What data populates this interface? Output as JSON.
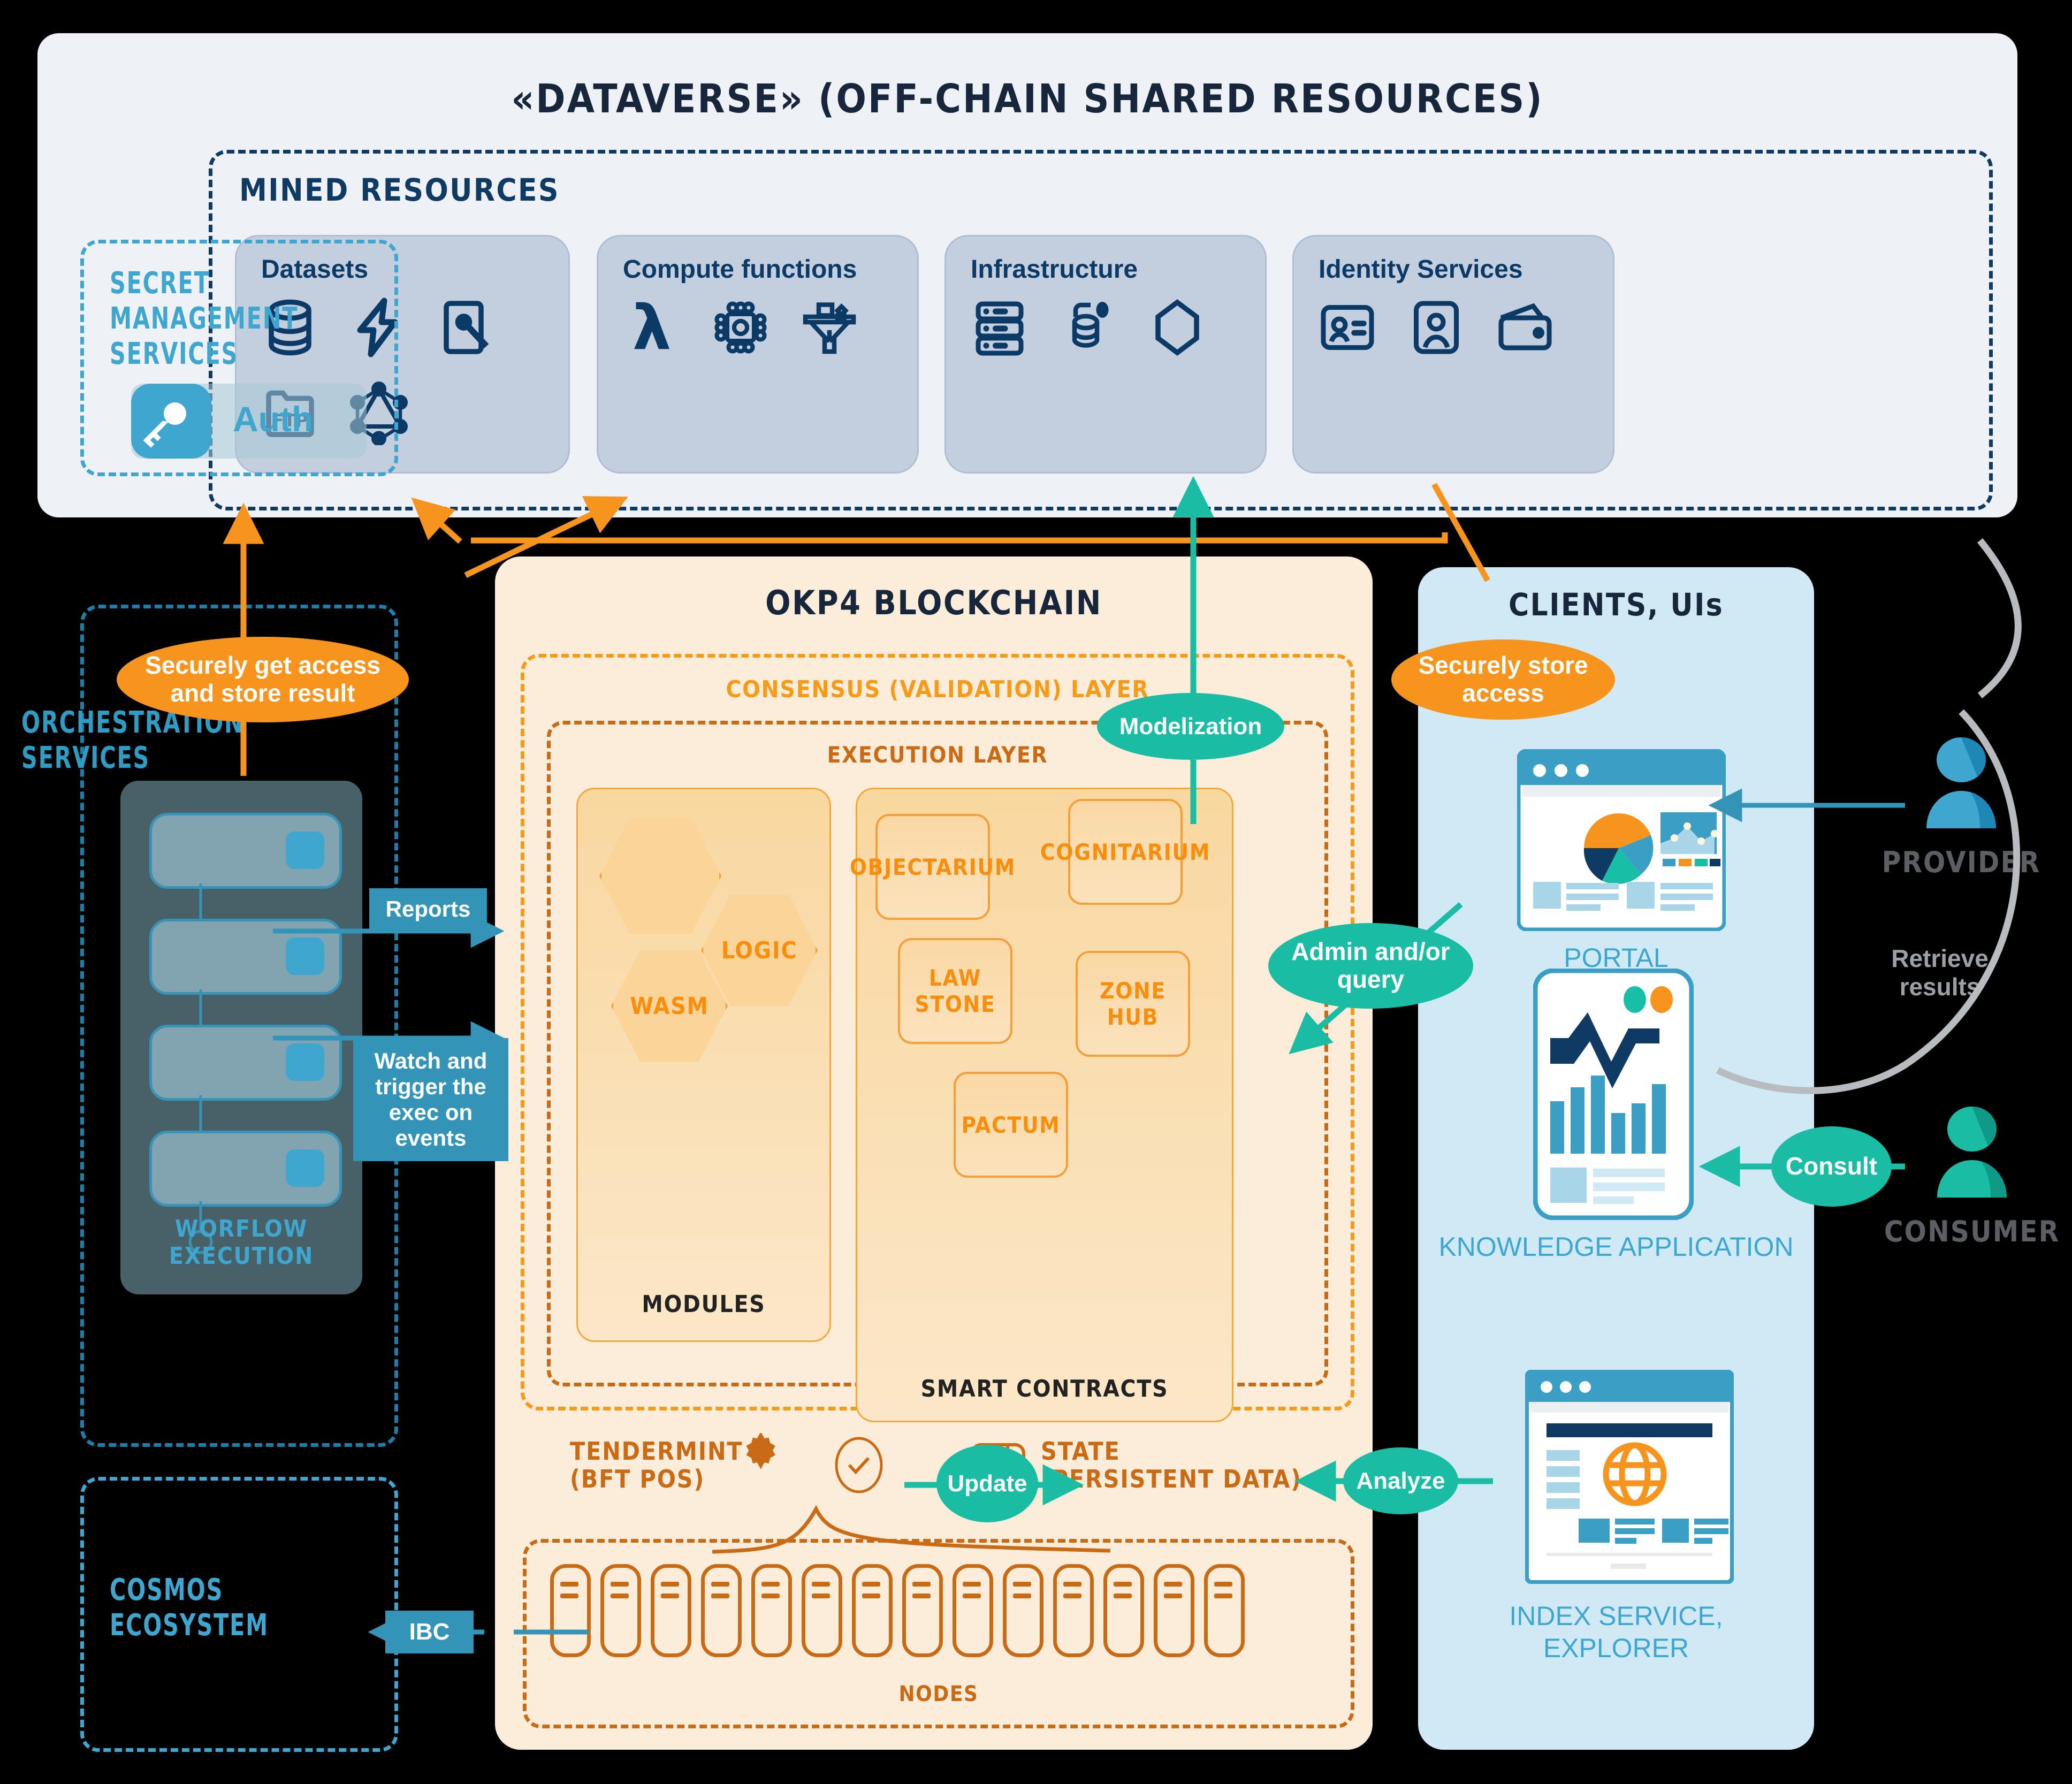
{
  "dataverse": {
    "title": "«DATAVERSE» (OFF-CHAIN SHARED RESOURCES)",
    "mined_title": "MINED RESOURCES",
    "cards": [
      {
        "title": "Datasets",
        "icons": [
          "database-icon",
          "lightning-icon",
          "edit-document-icon",
          "ftp-folder-icon",
          "graphql-icon"
        ]
      },
      {
        "title": "Compute functions",
        "icons": [
          "lambda-icon",
          "cpu-chip-icon",
          "funnel-icon"
        ]
      },
      {
        "title": "Infrastructure",
        "icons": [
          "server-icon",
          "containers-icon",
          "hexagon-icon"
        ]
      },
      {
        "title": "Identity Services",
        "icons": [
          "id-card-icon",
          "avatar-icon",
          "wallet-icon"
        ]
      }
    ]
  },
  "secret": {
    "title_line1": "SECRET MANAGEMENT",
    "title_line2": "SERVICES",
    "auth_label": "Auth",
    "auth_icon": "key-icon"
  },
  "orchestration": {
    "caption_line1": "ORCHESTRATION",
    "caption_line2": "SERVICES",
    "workflow_label": "WORFLOW EXECUTION",
    "steps": 4
  },
  "cosmos": {
    "line1": "COSMOS",
    "line2": "ECOSYSTEM"
  },
  "chain": {
    "title": "OKP4 BLOCKCHAIN",
    "consensus_layer": "CONSENSUS (VALIDATION) LAYER",
    "execution_layer": "EXECUTION LAYER",
    "modules_label": "MODULES",
    "modules": [
      "",
      "LOGIC",
      "WASM"
    ],
    "smart_contracts_label": "SMART CONTRACTS",
    "smart_contracts": [
      "OBJECTARIUM",
      "COGNITARIUM",
      "LAW STONE",
      "ZONE HUB",
      "PACTUM"
    ],
    "tendermint_line1": "TENDERMINT",
    "tendermint_line2": "(BFT POS)",
    "state_line1": "STATE",
    "state_line2": "(PERSISTENT DATA)",
    "nodes_label": "NODES",
    "node_count": 14
  },
  "clients": {
    "title": "CLIENTS, UIs",
    "portal_label": "PORTAL",
    "knowledge_label": "KNOWLEDGE APPLICATION",
    "index_line1": "INDEX SERVICE,",
    "index_line2": "EXPLORER"
  },
  "actors": {
    "provider": "PROVIDER",
    "consumer": "CONSUMER",
    "retrieve_line1": "Retrieve",
    "retrieve_line2": "results"
  },
  "flows": {
    "securely_get": "Securely get access and store result",
    "securely_store": "Securely store access",
    "reports": "Reports",
    "watch_trigger": "Watch and trigger the exec on events",
    "modelization": "Modelization",
    "admin_query": "Admin and/or query",
    "update": "Update",
    "analyze": "Analyze",
    "consult": "Consult",
    "ibc": "IBC"
  },
  "colors": {
    "navy": "#0e3a63",
    "sky": "#3fa6cf",
    "orange": "#f7941d",
    "amber": "#f59b18",
    "brown": "#c96a14",
    "teal": "#1ABCA4",
    "steel": "#3494b8",
    "gray": "#9aa0a4",
    "cream": "#fbedda",
    "ice": "#cfeaf5",
    "panel": "#eef1f6"
  }
}
